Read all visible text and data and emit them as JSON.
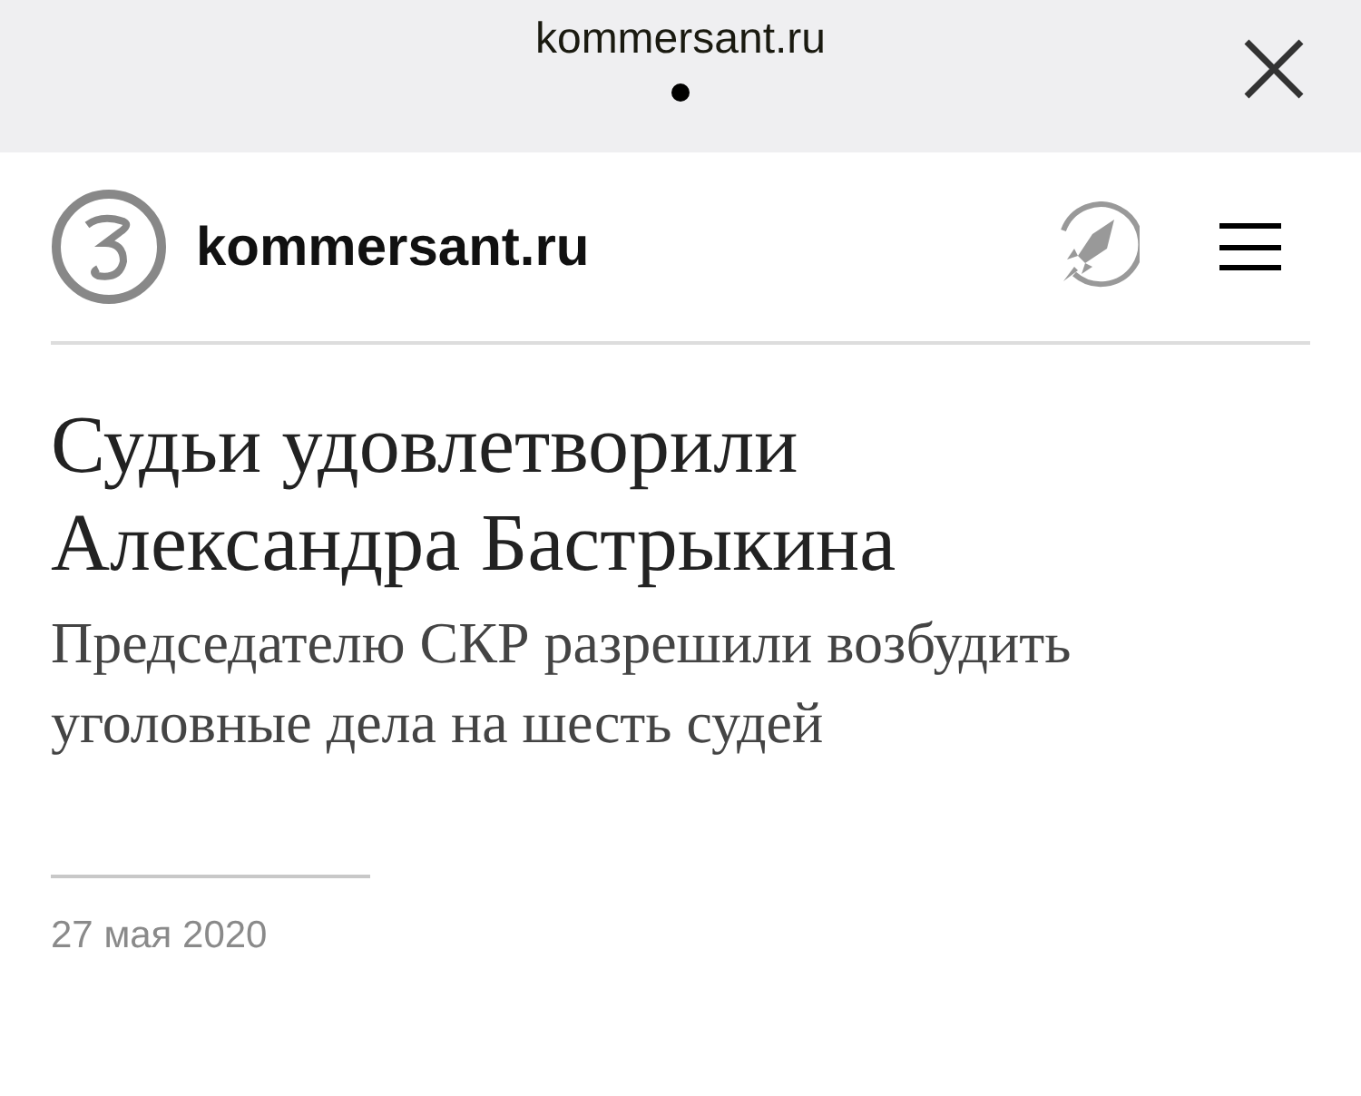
{
  "top_bar": {
    "title": "kommersant.ru"
  },
  "header": {
    "site_name": "kommersant.ru"
  },
  "article": {
    "title": "Судьи удовлетворили Александра Бастрыкина",
    "subtitle": "Председателю СКР разрешили возбудить уголовные дела на шесть судей",
    "date": "27 мая 2020"
  }
}
